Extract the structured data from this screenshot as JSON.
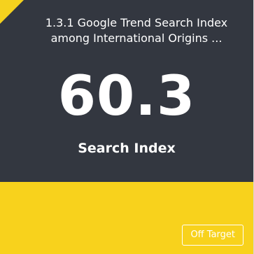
{
  "card": {
    "title": "1.3.1 Google Trend Search Index among International Origins ...",
    "value": "60.3",
    "label": "Search Index",
    "status": "Off Target"
  },
  "colors": {
    "top_background": "#333740",
    "bottom_background": "#f8d21c",
    "corner_flag": "#f5d21e",
    "text": "#ffffff"
  }
}
